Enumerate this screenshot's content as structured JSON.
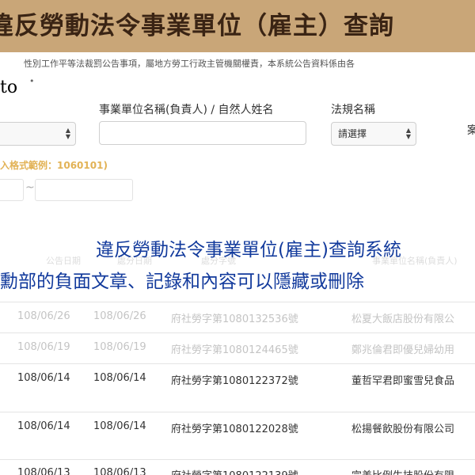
{
  "header": {
    "title": "違反勞動法令事業單位（雇主）查詢"
  },
  "notice": "性別工作平等法裁罰公告事項，屬地方勞工行政主管機關權責，本系統公告資料係由各",
  "side_label": "to",
  "side_dot": "•",
  "form": {
    "employer_label": "事業單位名稱(負責人) / 自然人姓名",
    "law_label": "法規名稱",
    "law_select_value": "請選擇",
    "right_label": "案",
    "date_hint": "入格式範例：1060101)",
    "date_separator": "~"
  },
  "overlay": {
    "line1": "違反勞動法令事業單位(雇主)查詢系統",
    "line2": "勳部的負面文章、記錄和內容可以隱藏或刪除"
  },
  "table": {
    "headers": [
      "公告日期",
      "處分日期",
      "處分字號",
      "事業單位名稱(負責人)"
    ],
    "rows": [
      {
        "announce": "108/06/26",
        "decision": "108/06/26",
        "doc": "府社勞字第1080132536號",
        "unit": "松夏大飯店股份有限公"
      },
      {
        "announce": "108/06/19",
        "decision": "108/06/19",
        "doc": "府社勞字第1080124465號",
        "unit": "鄭兆倫君即優兒婦幼用"
      },
      {
        "announce": "108/06/14",
        "decision": "108/06/14",
        "doc": "府社勞字第1080122372號",
        "unit": "董哲罕君即蜜雪兒食品"
      },
      {
        "announce": "108/06/14",
        "decision": "108/06/14",
        "doc": "府社勞字第1080122028號",
        "unit": "松揚餐飲股份有限公司"
      },
      {
        "announce": "108/06/13",
        "decision": "108/06/13",
        "doc": "府社勞字第1080122139號",
        "unit": "完美比例生技股份有限"
      }
    ]
  }
}
